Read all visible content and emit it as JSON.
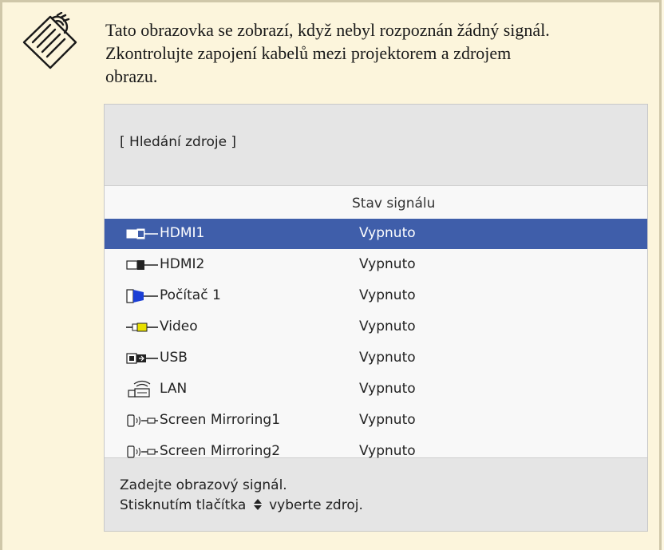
{
  "note": {
    "icon": "note-pencil-icon",
    "lines": [
      "Tato obrazovka se zobrazí, když nebyl rozpoznán žádný signál.",
      "Zkontrolujte zapojení kabelů mezi projektorem a zdrojem",
      "obrazu."
    ]
  },
  "panel": {
    "title": "[ Hledání zdroje ]",
    "column_header": "Stav signálu",
    "rows": [
      {
        "name": "HDMI1",
        "status": "Vypnuto",
        "icon": "hdmi-icon",
        "selected": true
      },
      {
        "name": "HDMI2",
        "status": "Vypnuto",
        "icon": "hdmi-icon",
        "selected": false
      },
      {
        "name": "Počítač 1",
        "status": "Vypnuto",
        "icon": "vga-computer-icon",
        "selected": false
      },
      {
        "name": "Video",
        "status": "Vypnuto",
        "icon": "rca-video-icon",
        "selected": false
      },
      {
        "name": "USB",
        "status": "Vypnuto",
        "icon": "usb-icon",
        "selected": false
      },
      {
        "name": "LAN",
        "status": "Vypnuto",
        "icon": "wireless-lan-icon",
        "selected": false
      },
      {
        "name": "Screen Mirroring1",
        "status": "Vypnuto",
        "icon": "screen-mirroring-icon",
        "selected": false
      },
      {
        "name": "Screen Mirroring2",
        "status": "Vypnuto",
        "icon": "screen-mirroring-icon",
        "selected": false
      }
    ],
    "footer": {
      "line1": "Zadejte obrazový signál.",
      "line2_prefix": "Stisknutím tlačítka",
      "line2_icon": "up-down-arrows-icon",
      "line2_suffix": "vyberte zdroj."
    }
  },
  "colors": {
    "note_background": "#fcf5dc",
    "note_border": "#cfc7a9",
    "panel_background": "#e5e5e5",
    "table_background": "#f8f8f8",
    "selection": "#3f5eaa",
    "vga_blue": "#1b3fd6",
    "video_yellow": "#e8e000"
  }
}
